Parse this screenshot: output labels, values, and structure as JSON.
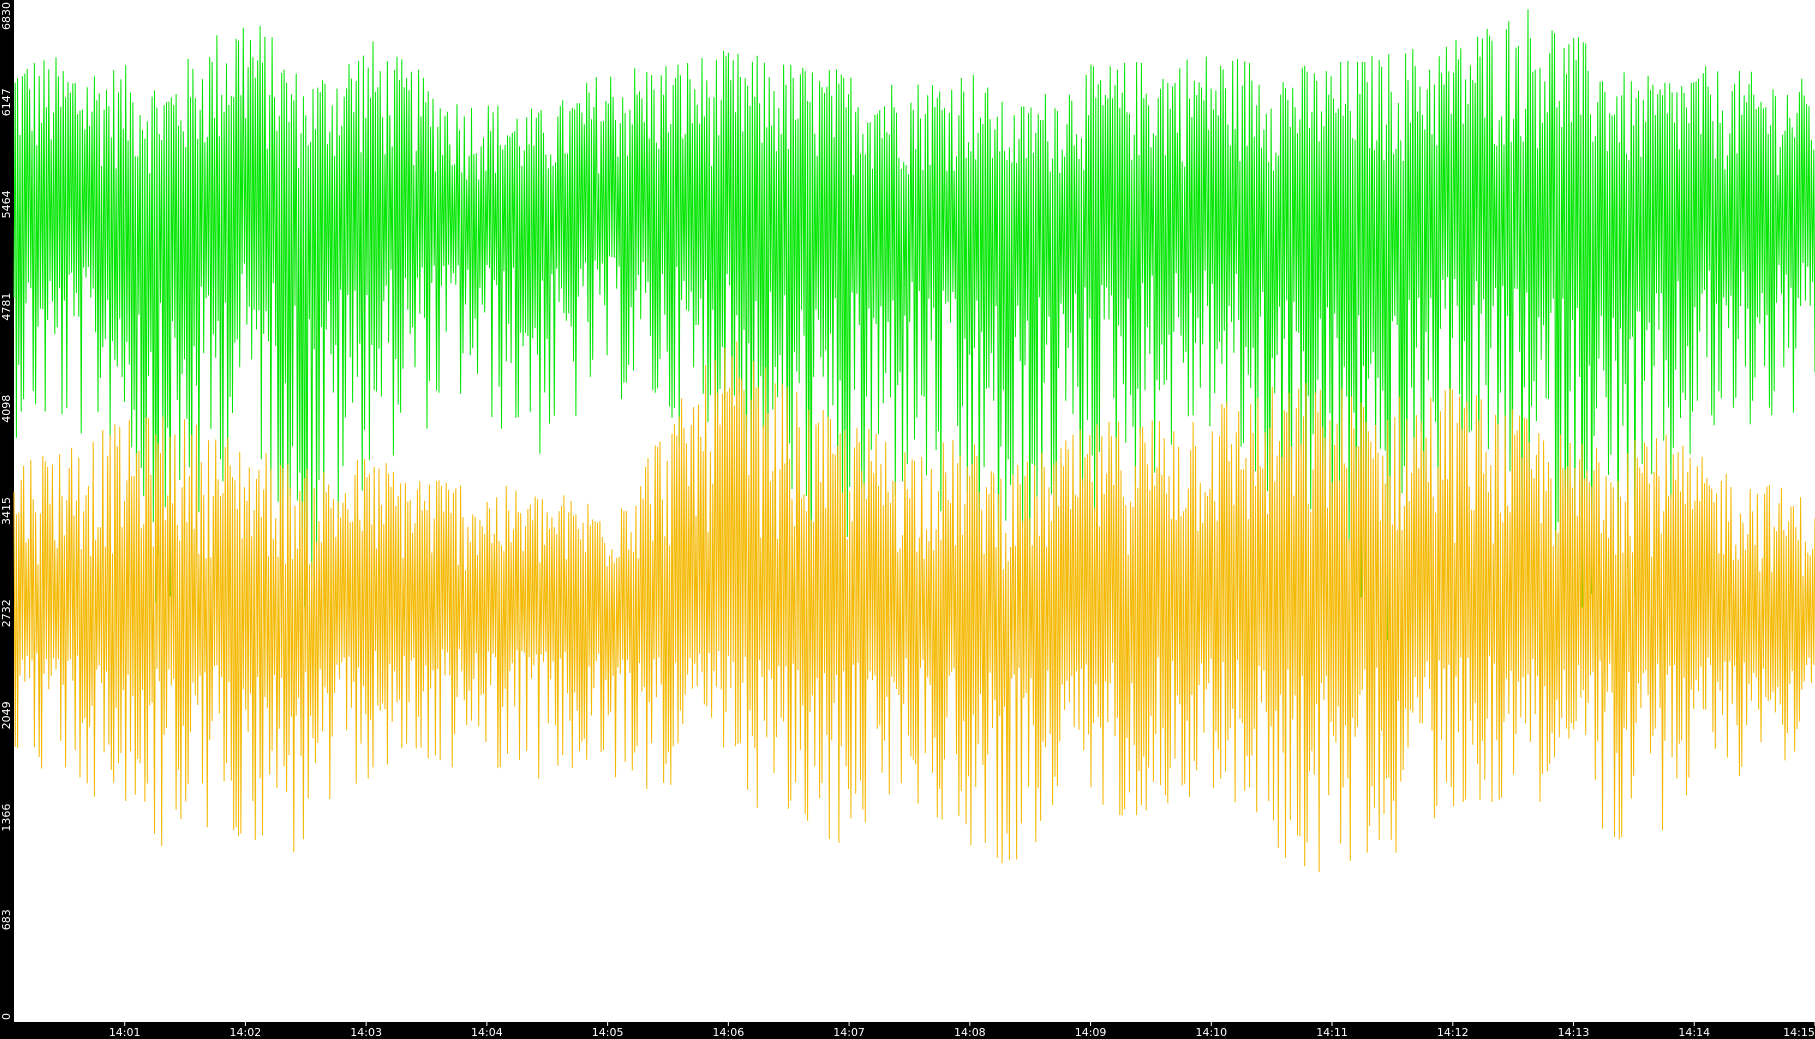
{
  "chart_data": {
    "type": "line",
    "title": "",
    "xlabel": "",
    "ylabel": "",
    "ylim": [
      0,
      6830
    ],
    "y_ticks": [
      0,
      683,
      1366,
      2049,
      2732,
      3415,
      4098,
      4781,
      5464,
      6147,
      6830
    ],
    "x_ticks": [
      "14:01",
      "14:02",
      "14:03",
      "14:04",
      "14:05",
      "14:06",
      "14:07",
      "14:08",
      "14:09",
      "14:10",
      "14:11",
      "14:12",
      "14:13",
      "14:14",
      "14:15"
    ],
    "x_range": [
      "14:00:05",
      "14:15:00"
    ],
    "legend": "none",
    "grid": false,
    "background": "#ffffff",
    "series": [
      {
        "color": "#00e600",
        "mean": 5350,
        "min": 2500,
        "max": 6830,
        "envelope": [
          {
            "time": "14:00:05",
            "lo": 3900,
            "hi": 6500
          },
          {
            "time": "14:01:00",
            "lo": 3800,
            "hi": 6400
          },
          {
            "time": "14:01:20",
            "lo": 2500,
            "hi": 6300
          },
          {
            "time": "14:02:00",
            "lo": 4000,
            "hi": 6830
          },
          {
            "time": "14:02:30",
            "lo": 2600,
            "hi": 6300
          },
          {
            "time": "14:03:00",
            "lo": 3600,
            "hi": 6600
          },
          {
            "time": "14:03:45",
            "lo": 4100,
            "hi": 6200
          },
          {
            "time": "14:04:30",
            "lo": 3700,
            "hi": 6100
          },
          {
            "time": "14:05:00",
            "lo": 4200,
            "hi": 6400
          },
          {
            "time": "14:06:00",
            "lo": 3600,
            "hi": 6500
          },
          {
            "time": "14:06:45",
            "lo": 2700,
            "hi": 6400
          },
          {
            "time": "14:07:30",
            "lo": 3500,
            "hi": 6300
          },
          {
            "time": "14:08:00",
            "lo": 2800,
            "hi": 6400
          },
          {
            "time": "14:08:20",
            "lo": 2600,
            "hi": 6100
          },
          {
            "time": "14:09:00",
            "lo": 3300,
            "hi": 6400
          },
          {
            "time": "14:10:00",
            "lo": 3900,
            "hi": 6500
          },
          {
            "time": "14:10:50",
            "lo": 2700,
            "hi": 6400
          },
          {
            "time": "14:11:30",
            "lo": 2400,
            "hi": 6500
          },
          {
            "time": "14:12:00",
            "lo": 3600,
            "hi": 6600
          },
          {
            "time": "14:12:40",
            "lo": 3000,
            "hi": 6830
          },
          {
            "time": "14:13:30",
            "lo": 2500,
            "hi": 6300
          },
          {
            "time": "14:14:00",
            "lo": 3700,
            "hi": 6400
          },
          {
            "time": "14:15:00",
            "lo": 4000,
            "hi": 6300
          }
        ]
      },
      {
        "color": "#f5b800",
        "mean": 2700,
        "min": 900,
        "max": 4600,
        "envelope": [
          {
            "time": "14:00:05",
            "lo": 1800,
            "hi": 3800
          },
          {
            "time": "14:01:20",
            "lo": 1100,
            "hi": 4100
          },
          {
            "time": "14:02:00",
            "lo": 1200,
            "hi": 3900
          },
          {
            "time": "14:02:30",
            "lo": 1000,
            "hi": 3700
          },
          {
            "time": "14:03:00",
            "lo": 1600,
            "hi": 3800
          },
          {
            "time": "14:04:00",
            "lo": 1700,
            "hi": 3600
          },
          {
            "time": "14:05:00",
            "lo": 1500,
            "hi": 3500
          },
          {
            "time": "14:06:00",
            "lo": 1600,
            "hi": 4600
          },
          {
            "time": "14:06:45",
            "lo": 1000,
            "hi": 4100
          },
          {
            "time": "14:07:30",
            "lo": 1500,
            "hi": 3900
          },
          {
            "time": "14:08:00",
            "lo": 1100,
            "hi": 3900
          },
          {
            "time": "14:08:20",
            "lo": 1000,
            "hi": 3700
          },
          {
            "time": "14:09:00",
            "lo": 1300,
            "hi": 4000
          },
          {
            "time": "14:10:00",
            "lo": 1500,
            "hi": 4200
          },
          {
            "time": "14:10:50",
            "lo": 900,
            "hi": 4300
          },
          {
            "time": "14:11:30",
            "lo": 1100,
            "hi": 4200
          },
          {
            "time": "14:12:00",
            "lo": 1400,
            "hi": 4300
          },
          {
            "time": "14:13:00",
            "lo": 1500,
            "hi": 3900
          },
          {
            "time": "14:13:30",
            "lo": 1000,
            "hi": 4100
          },
          {
            "time": "14:14:00",
            "lo": 1500,
            "hi": 3800
          },
          {
            "time": "14:15:00",
            "lo": 1800,
            "hi": 3500
          }
        ]
      }
    ]
  }
}
